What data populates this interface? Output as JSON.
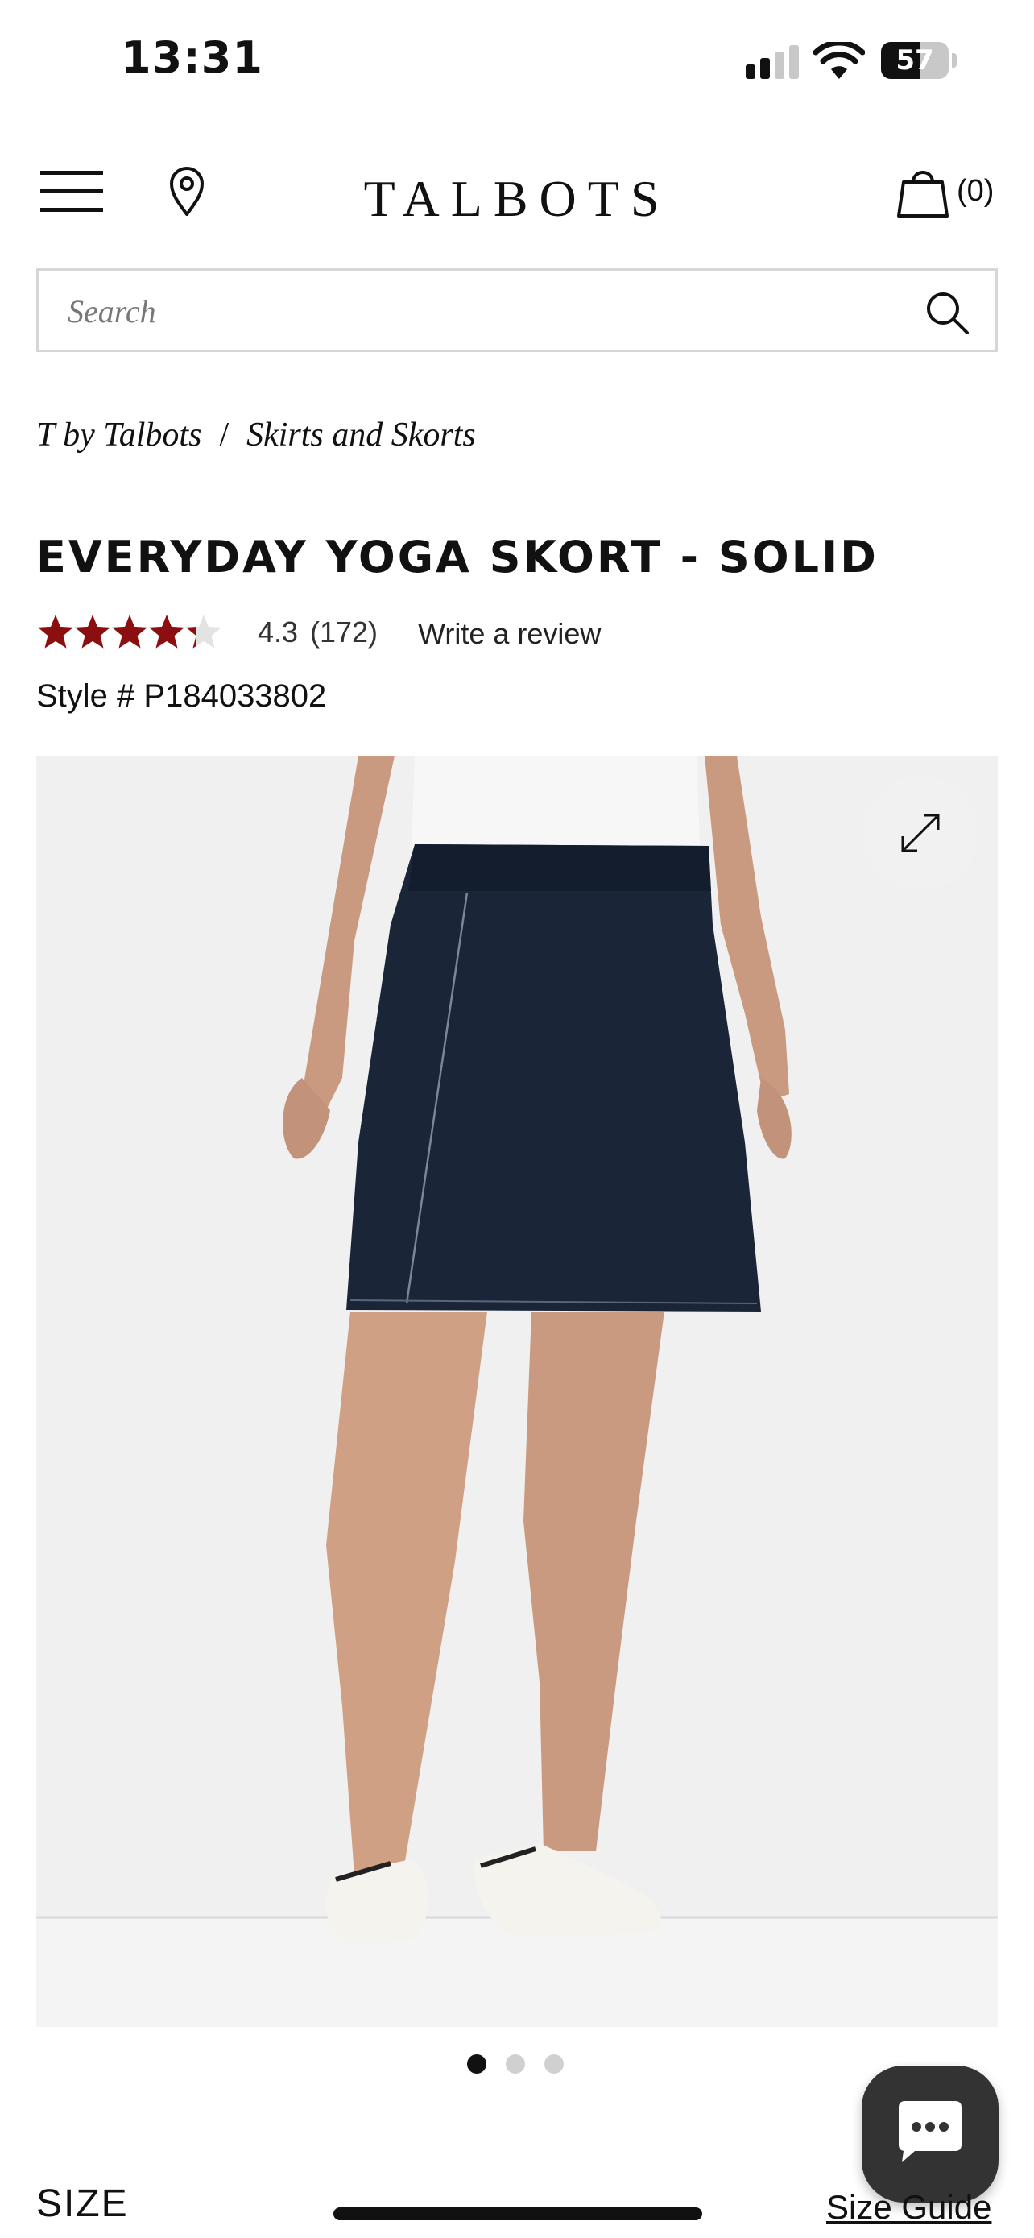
{
  "status_bar": {
    "time": "13:31",
    "battery_percent": "57",
    "battery_level": 0.57,
    "signal_bars_active": 2,
    "signal_bars_total": 4
  },
  "header": {
    "logo": "TALBOTS",
    "bag_count": "(0)"
  },
  "search": {
    "placeholder": "Search"
  },
  "breadcrumb": {
    "items": [
      "T by Talbots",
      "Skirts and Skorts"
    ],
    "separator": "/"
  },
  "product": {
    "title": "EVERYDAY YOGA SKORT - SOLID",
    "rating": "4.3",
    "rating_value": 4.3,
    "rating_max": 5,
    "review_count": "(172)",
    "write_review": "Write a review",
    "style_number": "Style # P184033802"
  },
  "carousel": {
    "total_images": 3,
    "active_index": 0
  },
  "size_section": {
    "label": "SIZE",
    "size_guide": "Size Guide"
  },
  "colors": {
    "star": "#8b0f10",
    "star_empty": "#e3e3e3",
    "skirt": "#1a2538",
    "text": "#111111",
    "dot_active": "#111111",
    "dot_inactive": "#d0d0d0",
    "chat_bg": "#333333"
  },
  "icons": {
    "menu": "hamburger-menu-icon",
    "location": "map-pin-icon",
    "bag": "shopping-bag-icon",
    "search": "search-icon",
    "expand": "expand-icon",
    "chat": "chat-bubble-icon"
  }
}
